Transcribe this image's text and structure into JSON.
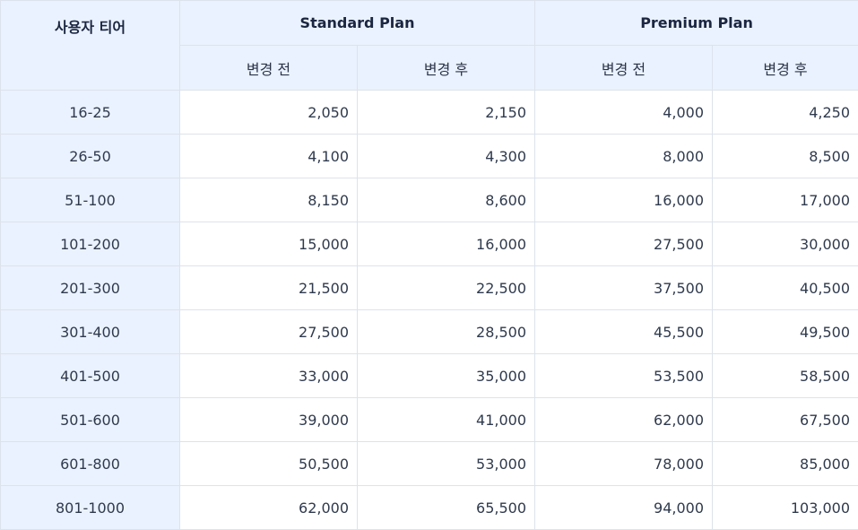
{
  "table": {
    "header": {
      "tier": "사용자 티어",
      "standard_plan": "Standard Plan",
      "premium_plan": "Premium Plan",
      "before": "변경 전",
      "after": "변경 후"
    },
    "rows": [
      {
        "tier": "16-25",
        "std_before": "2,050",
        "std_after": "2,150",
        "prem_before": "4,000",
        "prem_after": "4,250"
      },
      {
        "tier": "26-50",
        "std_before": "4,100",
        "std_after": "4,300",
        "prem_before": "8,000",
        "prem_after": "8,500"
      },
      {
        "tier": "51-100",
        "std_before": "8,150",
        "std_after": "8,600",
        "prem_before": "16,000",
        "prem_after": "17,000"
      },
      {
        "tier": "101-200",
        "std_before": "15,000",
        "std_after": "16,000",
        "prem_before": "27,500",
        "prem_after": "30,000"
      },
      {
        "tier": "201-300",
        "std_before": "21,500",
        "std_after": "22,500",
        "prem_before": "37,500",
        "prem_after": "40,500"
      },
      {
        "tier": "301-400",
        "std_before": "27,500",
        "std_after": "28,500",
        "prem_before": "45,500",
        "prem_after": "49,500"
      },
      {
        "tier": "401-500",
        "std_before": "33,000",
        "std_after": "35,000",
        "prem_before": "53,500",
        "prem_after": "58,500"
      },
      {
        "tier": "501-600",
        "std_before": "39,000",
        "std_after": "41,000",
        "prem_before": "62,000",
        "prem_after": "67,500"
      },
      {
        "tier": "601-800",
        "std_before": "50,500",
        "std_after": "53,000",
        "prem_before": "78,000",
        "prem_after": "85,000"
      },
      {
        "tier": "801-1000",
        "std_before": "62,000",
        "std_after": "65,500",
        "prem_before": "94,000",
        "prem_after": "103,000"
      }
    ]
  }
}
